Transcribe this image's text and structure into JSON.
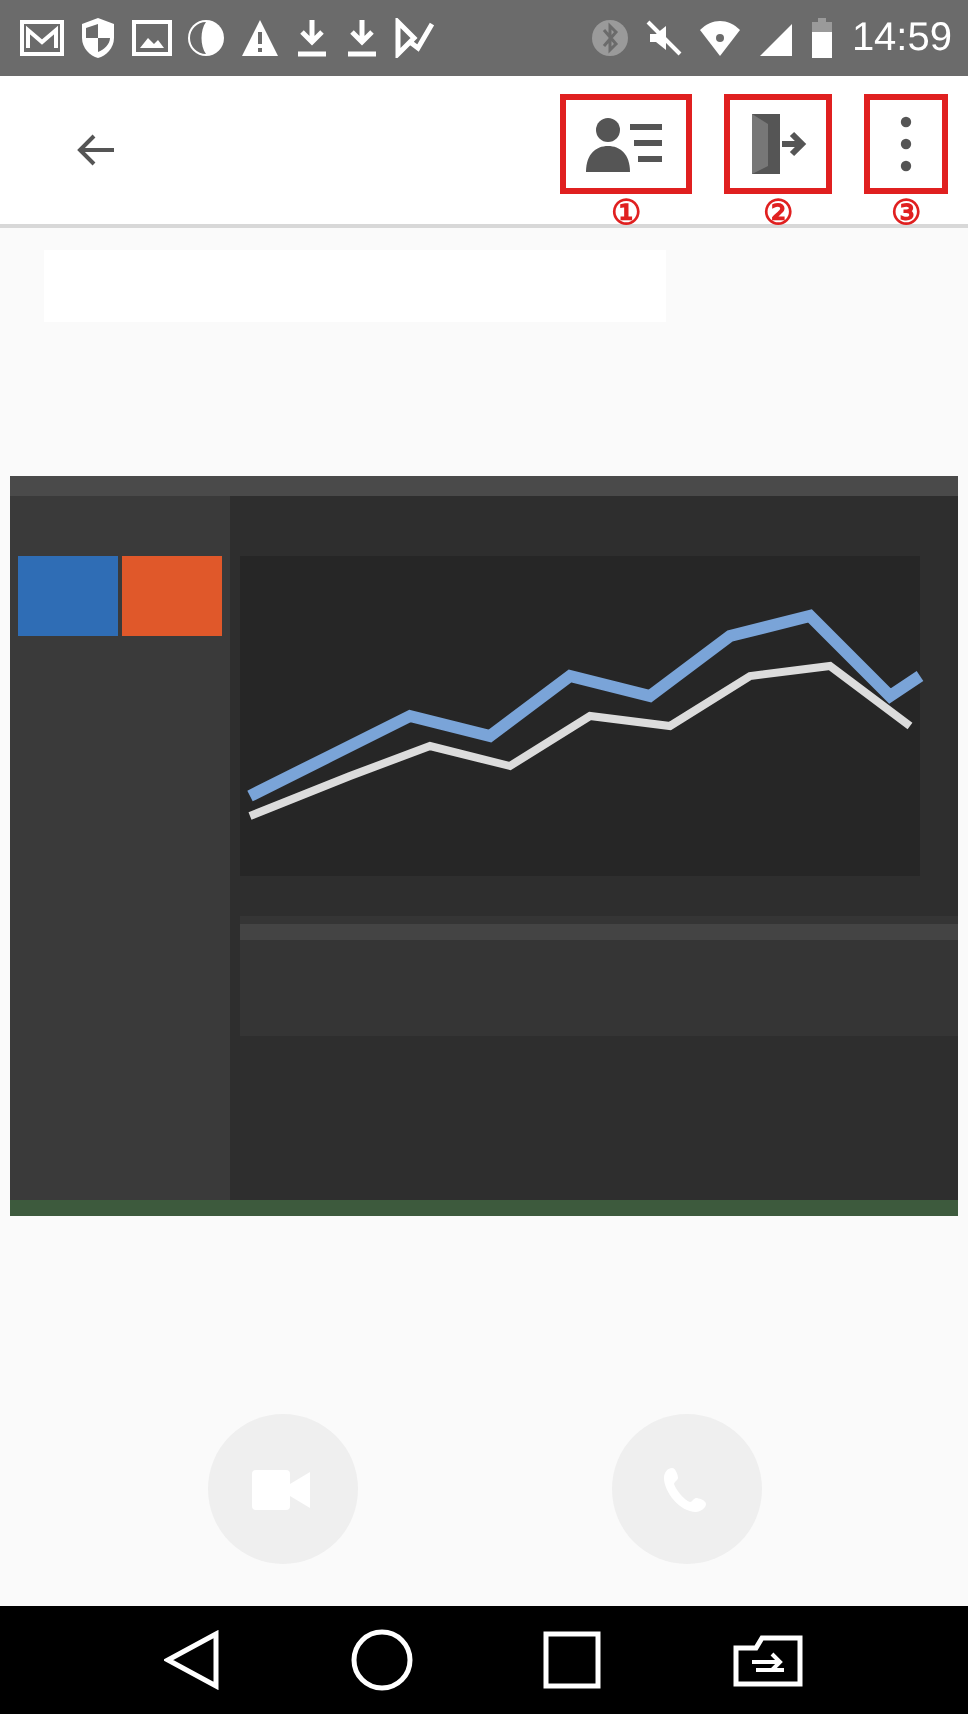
{
  "status_bar": {
    "time": "14:59"
  },
  "toolbar": {
    "actions": [
      {
        "kind": "contacts",
        "callout": "①"
      },
      {
        "kind": "exit",
        "callout": "②"
      },
      {
        "kind": "more",
        "callout": "③"
      }
    ]
  },
  "call_buttons": [
    {
      "kind": "video",
      "disabled": true
    },
    {
      "kind": "phone",
      "disabled": true
    }
  ]
}
